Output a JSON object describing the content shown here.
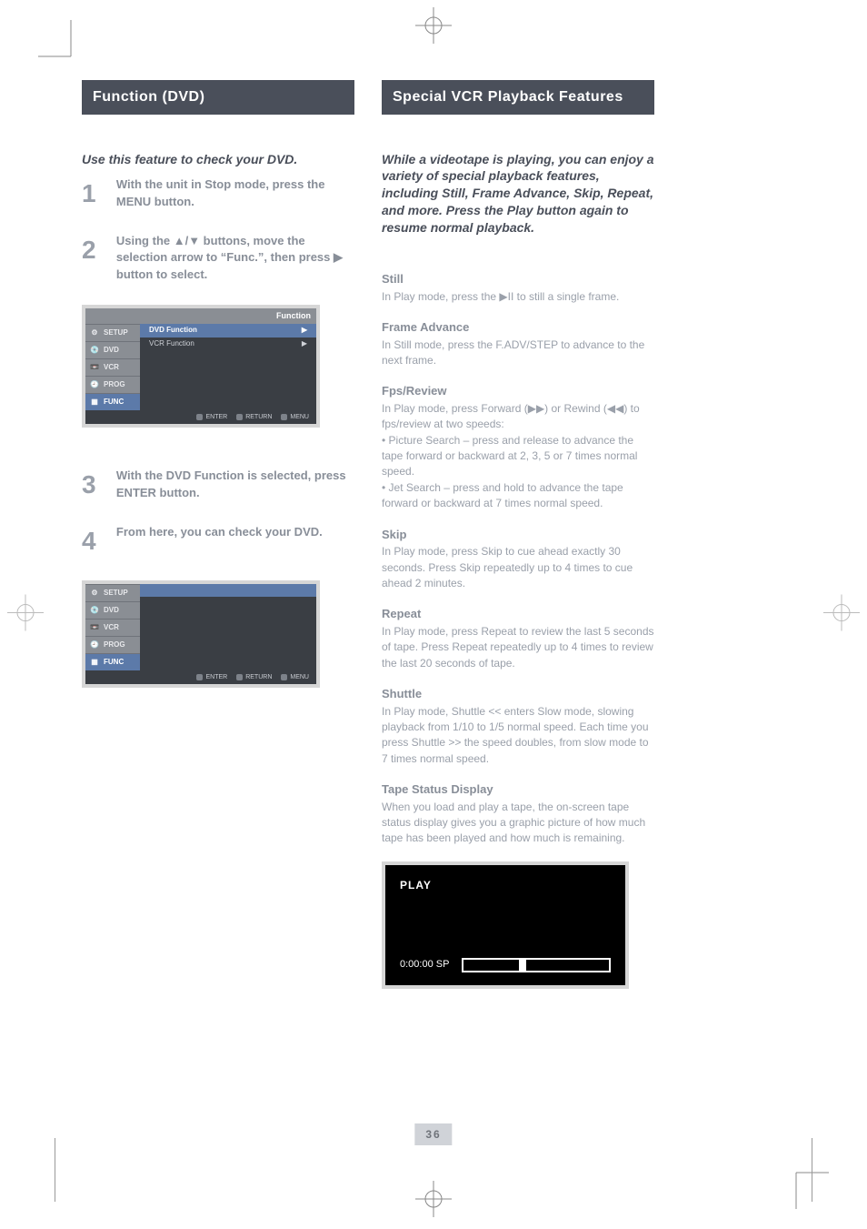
{
  "crop_marks": true,
  "left": {
    "heading": "Function (DVD)",
    "intro": "Use this feature to check your DVD.",
    "steps": {
      "s1": {
        "n": "1",
        "title": "With the unit in Stop mode, press the MENU button.",
        "text": ""
      },
      "s2": {
        "n": "2",
        "title": "Using the ▲/▼ buttons, move the selection arrow to “Func.”, then press ▶ button to select."
      },
      "s3": {
        "n": "3",
        "title": "With the DVD Function is selected, press ENTER button."
      },
      "s4": {
        "n": "4",
        "title": "From here, you can check your DVD."
      }
    },
    "menu": {
      "title": "Function",
      "tabs": [
        "SETUP",
        "DVD",
        "VCR",
        "PROG",
        "FUNC"
      ],
      "options": [
        {
          "label": "DVD Function",
          "sel": true
        },
        {
          "label": "VCR Function",
          "sel": false
        }
      ],
      "footer": [
        "ENTER",
        "RETURN",
        "MENU"
      ]
    },
    "menu2": {
      "tabs": [
        "SETUP",
        "DVD",
        "VCR",
        "PROG",
        "FUNC"
      ],
      "footer": [
        "ENTER",
        "RETURN",
        "MENU"
      ]
    }
  },
  "right": {
    "heading": "Special VCR Playback Features",
    "intro": "While a videotape is playing, you can enjoy a variety of special playback features, including Still, Frame Advance, Skip, Repeat, and more. Press the Play button again to resume normal playback.",
    "sections": {
      "still": {
        "h": "Still",
        "p": "In Play mode, press the ▶II to still a single frame."
      },
      "frame": {
        "h": "Frame Advance",
        "p": "In Still mode, press the F.ADV/STEP to advance to the next frame."
      },
      "fwd": {
        "h": "Fps/Review",
        "p": "In Play mode, press Forward (▶▶) or Rewind (◀◀) to fps/review at two speeds:\n• Picture Search – press and release to advance the tape forward or backward at 2, 3, 5 or 7 times normal speed.\n• Jet Search – press and hold to advance the tape forward or backward at 7 times normal speed."
      },
      "skip": {
        "h": "Skip",
        "p": "In Play mode, press Skip to cue ahead exactly 30 seconds. Press Skip repeatedly up to 4 times to cue ahead 2 minutes."
      },
      "repeat": {
        "h": "Repeat",
        "p": "In Play mode, press Repeat to review the last 5 seconds of tape. Press Repeat repeatedly up to 4 times to review the last 20 seconds of tape."
      },
      "slow": {
        "h": "Shuttle",
        "p": "In Play mode, Shuttle << enters Slow mode, slowing playback from 1/10 to 1/5 normal speed. Each time you press Shuttle >> the speed doubles, from slow mode to 7 times normal speed."
      },
      "tape": {
        "h": "Tape Status Display",
        "p": "When you load and play a tape, the on-screen tape status display gives you a graphic picture of how much tape has been played and how much is remaining."
      }
    },
    "tv": {
      "play": "PLAY",
      "counter": "0:00:00 SP"
    }
  },
  "page_number": "36"
}
